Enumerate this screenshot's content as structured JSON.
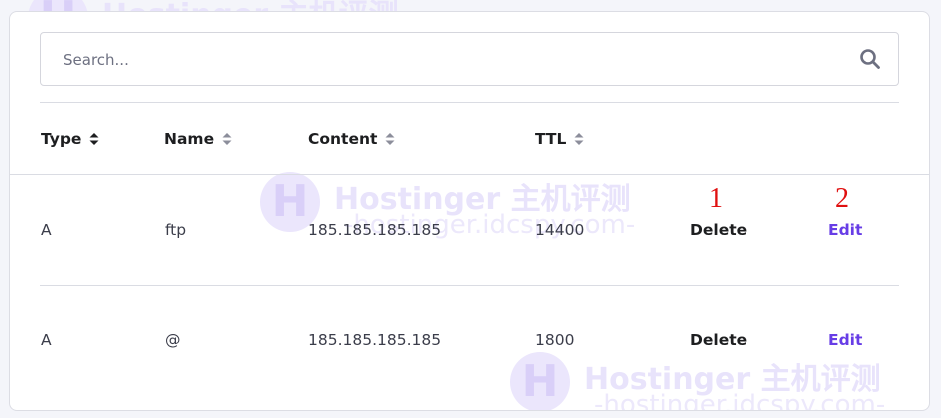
{
  "search": {
    "placeholder": "Search..."
  },
  "table": {
    "headers": [
      "Type",
      "Name",
      "Content",
      "TTL"
    ],
    "rows": [
      {
        "type": "A",
        "name": "ftp",
        "content": "185.185.185.185",
        "ttl": "14400",
        "delete_label": "Delete",
        "edit_label": "Edit"
      },
      {
        "type": "A",
        "name": "@",
        "content": "185.185.185.185",
        "ttl": "1800",
        "delete_label": "Delete",
        "edit_label": "Edit"
      }
    ]
  },
  "annotations": {
    "delete_marker": "1",
    "edit_marker": "2"
  },
  "watermark": {
    "logo_letter": "H",
    "title": "Hostinger 主机评测",
    "subtitle": "-hostinger.idcspy.com-"
  },
  "colors": {
    "accent": "#673de6",
    "annotation": "#e01010",
    "text_dark": "#1d1e20",
    "text_body": "#3b3d4a",
    "background": "#f4f5fa"
  }
}
